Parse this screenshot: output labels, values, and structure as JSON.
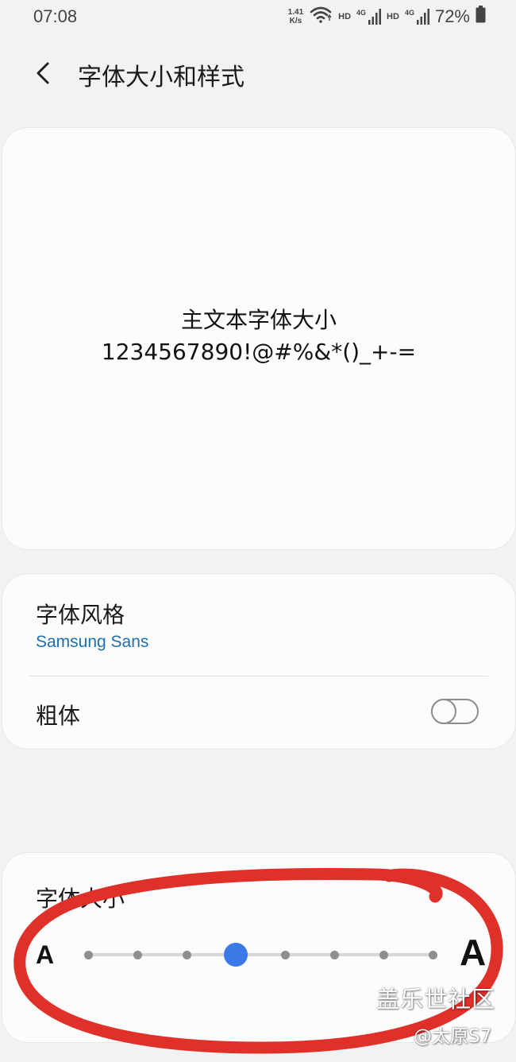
{
  "status_bar": {
    "time": "07:08",
    "net_speed_value": "1.41",
    "net_speed_unit": "K/s",
    "hd_label_1": "HD",
    "net_type_1": "4G",
    "hd_label_2": "HD",
    "net_type_2": "4G",
    "battery_percent": "72%"
  },
  "header": {
    "title": "字体大小和样式"
  },
  "preview": {
    "line1": "主文本字体大小",
    "line2": "1234567890!@#%&*()_+-="
  },
  "font_style": {
    "title": "字体风格",
    "value": "Samsung Sans",
    "value_color": "#1e6fa8"
  },
  "bold": {
    "title": "粗体",
    "enabled": false
  },
  "font_size": {
    "title": "字体大小",
    "small_label": "A",
    "large_label": "A",
    "steps": 8,
    "selected_step": 4,
    "accent_color": "#3a79e6"
  },
  "annotation": {
    "color": "#e0302a"
  },
  "watermark": {
    "line1": "盖乐世社区",
    "line2": "@太原S7"
  }
}
